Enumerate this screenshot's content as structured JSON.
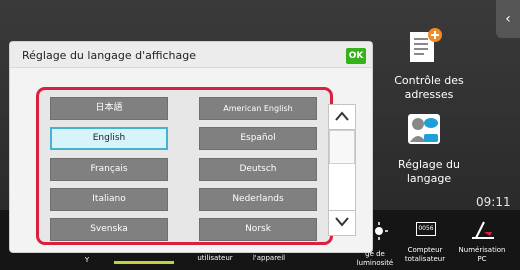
{
  "dialog": {
    "title": "Réglage du langage d'affichage",
    "ok_label": "OK",
    "languages": [
      "日本語",
      "American English",
      "English",
      "Español",
      "Français",
      "Deutsch",
      "Italiano",
      "Nederlands",
      "Svenska",
      "Norsk"
    ],
    "selected": "English"
  },
  "apps": {
    "address_check": "Contrôle des adresses",
    "language_setting": "Réglage du langage"
  },
  "clock": "09:11",
  "bottom_bar": {
    "user": "utilisateur",
    "device": "l'appareil",
    "brightness": "ge de luminosité",
    "counter_title": "Compteur",
    "counter_sub": "totalisateur",
    "scan_title": "Numérisation",
    "scan_sub": "PC",
    "left_letter": "Y"
  },
  "colors": {
    "ok": "#35b21a",
    "selected_bg": "#d7f4fa",
    "frame": "#d9203c"
  }
}
